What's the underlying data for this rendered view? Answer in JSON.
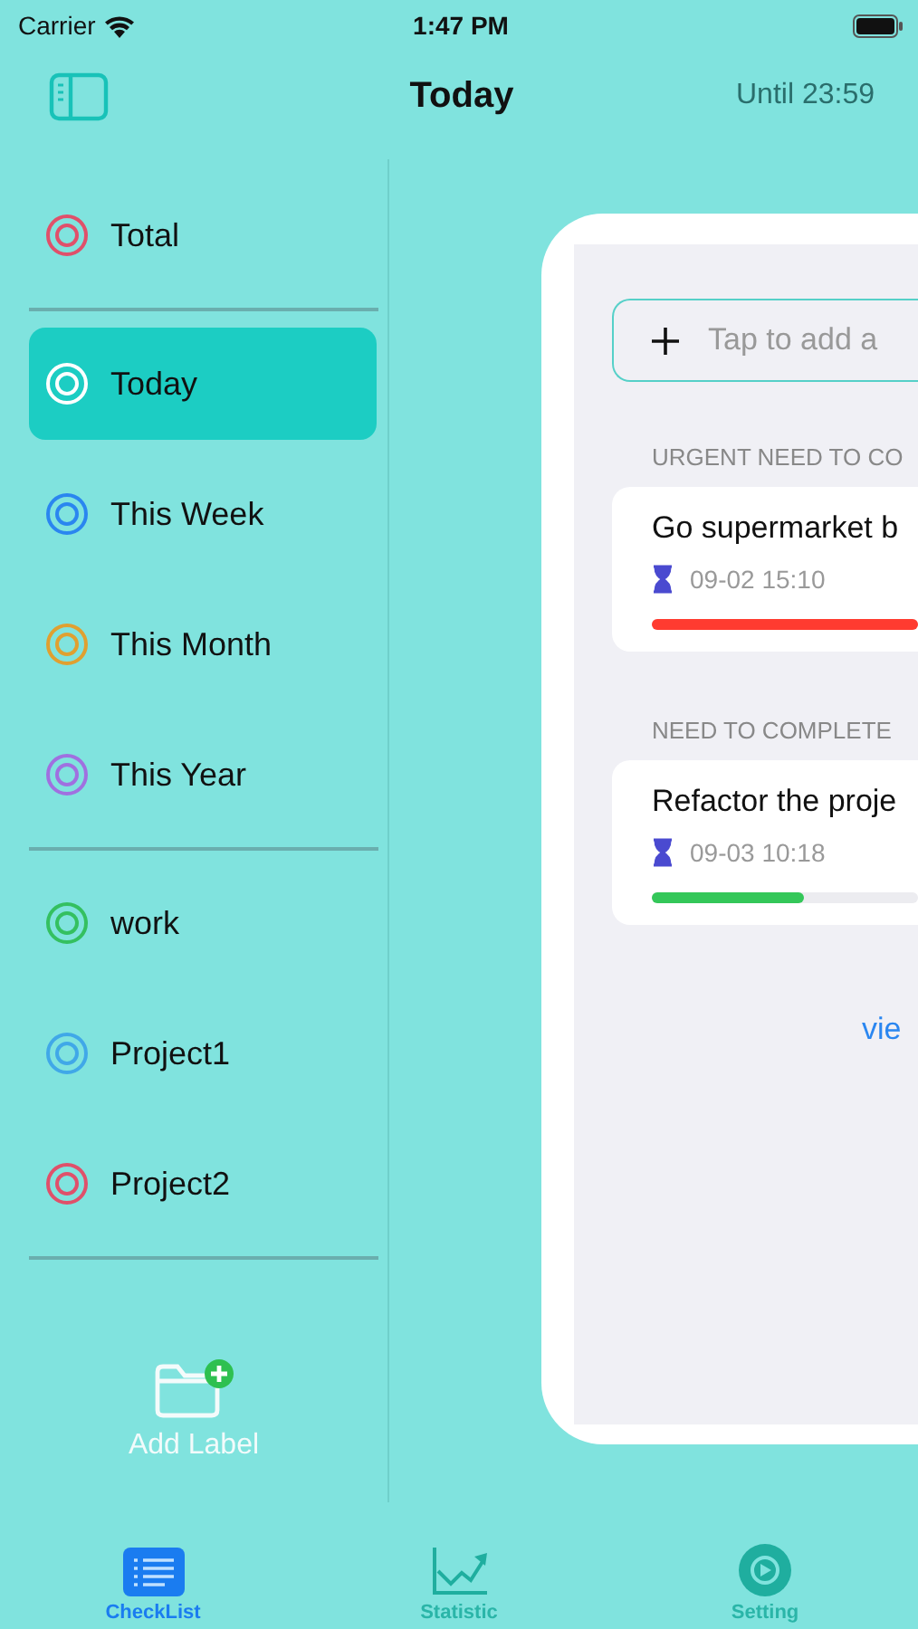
{
  "status_bar": {
    "carrier": "Carrier",
    "time": "1:47 PM"
  },
  "nav": {
    "title": "Today",
    "until": "Until 23:59"
  },
  "sidebar": {
    "groups": [
      [
        {
          "name": "Total",
          "color": "#e0506a",
          "selected": false
        }
      ],
      [
        {
          "name": "Today",
          "color": "#ffffff",
          "selected": true
        },
        {
          "name": "This Week",
          "color": "#2a86f0",
          "selected": false
        },
        {
          "name": "This Month",
          "color": "#e0a030",
          "selected": false
        },
        {
          "name": "This Year",
          "color": "#a070e0",
          "selected": false
        }
      ],
      [
        {
          "name": "work",
          "color": "#34c060",
          "selected": false
        },
        {
          "name": "Project1",
          "color": "#40a8e8",
          "selected": false
        },
        {
          "name": "Project2",
          "color": "#e0506a",
          "selected": false
        }
      ]
    ],
    "add_label": "Add Label"
  },
  "panel": {
    "add_placeholder": "Tap to add a",
    "sections": [
      {
        "title": "URGENT NEED TO CO",
        "tasks": [
          {
            "title": "Go supermarket b",
            "due": "09-02 15:10",
            "level": 1,
            "color": "#ff3b30"
          }
        ]
      },
      {
        "title": "NEED TO COMPLETE",
        "tasks": [
          {
            "title": "Refactor the proje",
            "due": "09-03 10:18",
            "level": 0.57,
            "color": "#34c759"
          }
        ]
      }
    ],
    "link": "vie"
  },
  "tabs": [
    {
      "label": "CheckList",
      "kind": "list",
      "selected": true
    },
    {
      "label": "Statistic",
      "kind": "chart",
      "selected": false
    },
    {
      "label": "Setting",
      "kind": "gear",
      "selected": false
    }
  ]
}
